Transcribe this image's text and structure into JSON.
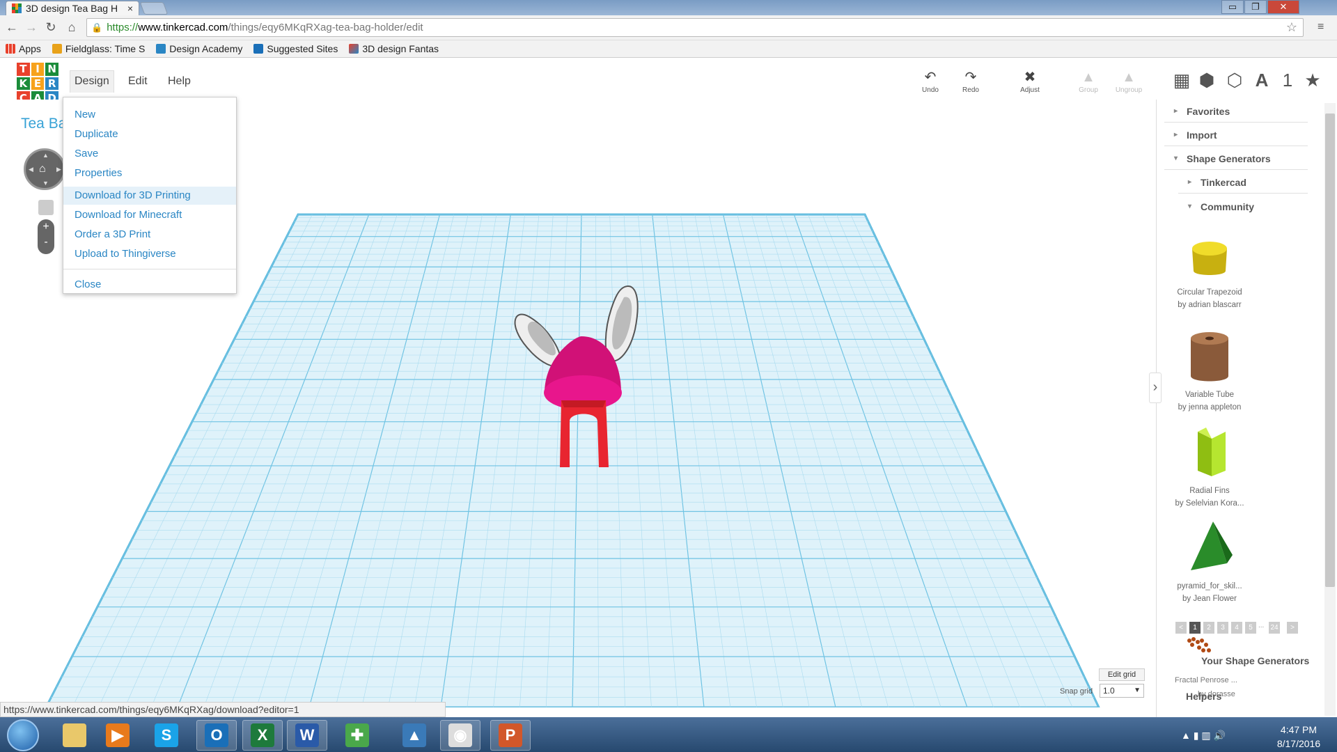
{
  "browser": {
    "tab_title": "3D design Tea Bag H",
    "tab_close": "×",
    "window_controls": [
      "▭",
      "❐",
      "✕"
    ],
    "url_https": "https://",
    "url_host": "www.tinkercad.com",
    "url_path": "/things/eqy6MKqRXag-tea-bag-holder/edit",
    "bookmarks": [
      "Apps",
      "Fieldglass: Time S",
      "Design Academy",
      "Suggested Sites",
      "3D design Fantas"
    ],
    "status_url": "https://www.tinkercad.com/things/eqy6MKqRXag/download?editor=1"
  },
  "app": {
    "logo_letters": [
      "T",
      "I",
      "N",
      "K",
      "E",
      "R",
      "C",
      "A",
      "D"
    ],
    "logo_colors": [
      "#e8412c",
      "#f7a21c",
      "#1b8c3a",
      "#1b8c3a",
      "#f7a21c",
      "#2a86c4",
      "#e8412c",
      "#1b8c3a",
      "#2a86c4"
    ],
    "menus": [
      "Design",
      "Edit",
      "Help"
    ],
    "design_title": "Tea Ba",
    "tools": [
      {
        "icon": "↶",
        "label": "Undo",
        "enabled": true
      },
      {
        "icon": "↷",
        "label": "Redo",
        "enabled": true
      },
      {
        "icon": "✖",
        "label": "Adjust",
        "enabled": true
      },
      {
        "icon": "▲",
        "label": "Group",
        "enabled": false
      },
      {
        "icon": "▲",
        "label": "Ungroup",
        "enabled": false
      }
    ],
    "view_icons": [
      "▦",
      "⬢",
      "⬡",
      "A",
      "1",
      "★"
    ],
    "accent_color": "#37a2d6"
  },
  "design_menu": {
    "items": [
      "New",
      "Duplicate",
      "Save",
      "Properties",
      "Download for 3D Printing",
      "Download for Minecraft",
      "Order a 3D Print",
      "Upload to Thingiverse",
      "Close"
    ],
    "highlighted": "Download for 3D Printing"
  },
  "panel": {
    "sections": [
      "Favorites",
      "Import",
      "Shape Generators",
      "Tinkercad",
      "Community"
    ],
    "shapes": [
      {
        "name": "Circular Trapezoid",
        "author": "by adrian blascarr",
        "color": "#e8d21a"
      },
      {
        "name": "Variable Tube",
        "author": "by jenna appleton",
        "color": "#8a5a3a"
      },
      {
        "name": "Radial Fins",
        "author": "by Selelvian Kora...",
        "color": "#a6d81e"
      },
      {
        "name": "pyramid_for_skil...",
        "author": "by Jean Flower",
        "color": "#2a8c2a"
      }
    ],
    "pagination": [
      "<",
      "1",
      "2",
      "3",
      "4",
      "5",
      "...",
      "24",
      ">"
    ],
    "current_page": "1",
    "your_shape_generators": "Your Shape Generators",
    "overlap_title": "Fractal Penrose ...",
    "overlap_author": "by dorasse",
    "helpers": "Helpers"
  },
  "workplane": {
    "edit_grid": "Edit grid",
    "snap_grid_label": "Snap grid",
    "snap_grid_value": "1.0",
    "zoom_in": "+",
    "zoom_out": "-"
  },
  "taskbar": {
    "time": "4:47 PM",
    "date": "8/17/2016",
    "apps": [
      {
        "name": "file-explorer",
        "glyph": "",
        "bg": "#e9c86a"
      },
      {
        "name": "media-player",
        "glyph": "▶",
        "bg": "#e87a1c"
      },
      {
        "name": "skype",
        "glyph": "S",
        "bg": "#1aa3e8"
      },
      {
        "name": "outlook",
        "glyph": "O",
        "bg": "#1a6fb8"
      },
      {
        "name": "excel",
        "glyph": "X",
        "bg": "#1e7a3c"
      },
      {
        "name": "word",
        "glyph": "W",
        "bg": "#2a5aa8"
      },
      {
        "name": "security",
        "glyph": "✚",
        "bg": "#4aa84a"
      },
      {
        "name": "autodesk",
        "glyph": "▲",
        "bg": "#3a7ab8"
      },
      {
        "name": "chrome",
        "glyph": "◉",
        "bg": "#dddddd"
      },
      {
        "name": "powerpoint",
        "glyph": "P",
        "bg": "#d2572a"
      }
    ]
  }
}
